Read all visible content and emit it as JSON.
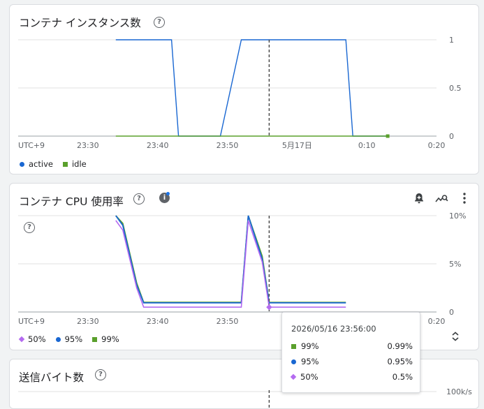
{
  "colors": {
    "active": "#1967d2",
    "idle": "#5aa02c",
    "p50": "#b46bf0",
    "p95": "#1967d2",
    "p99": "#5aa02c",
    "grid": "#e0e0e0",
    "cursor": "#444444"
  },
  "time_axis": {
    "tick_labels": [
      "UTC+9",
      "23:30",
      "23:40",
      "23:50",
      "5月17日",
      "0:10",
      "0:20"
    ]
  },
  "cards": {
    "instances": {
      "title": "コンテナ インスタンス数",
      "help": "?",
      "legend": [
        {
          "label": "active",
          "marker": "dot",
          "color": "#1967d2"
        },
        {
          "label": "idle",
          "marker": "square",
          "color": "#5aa02c"
        }
      ]
    },
    "cpu": {
      "title": "コンテナ CPU 使用率",
      "help": "?",
      "info": "i",
      "inner_help": "?",
      "toolbar": {
        "alert_icon": "add-alert-icon",
        "explore_icon": "query-stats-icon",
        "more_icon": "more-vert-icon"
      },
      "legend": [
        {
          "label": "50%",
          "marker": "diamond",
          "color": "#b46bf0"
        },
        {
          "label": "95%",
          "marker": "dot",
          "color": "#1967d2"
        },
        {
          "label": "99%",
          "marker": "square",
          "color": "#5aa02c"
        }
      ],
      "tooltip": {
        "date": "2026/05/16 23:56:00",
        "rows": [
          {
            "label": "99%",
            "value": "0.99%",
            "marker": "square",
            "color": "#5aa02c"
          },
          {
            "label": "95%",
            "value": "0.95%",
            "marker": "dot",
            "color": "#1967d2"
          },
          {
            "label": "50%",
            "value": "0.5%",
            "marker": "diamond",
            "color": "#b46bf0"
          }
        ]
      },
      "expand_icon": "unfold-icon"
    },
    "bytes": {
      "title": "送信バイト数",
      "help": "?"
    }
  },
  "chart_data": [
    {
      "type": "line",
      "title": "コンテナ インスタンス数",
      "x_ticks": [
        "23:30",
        "23:40",
        "23:50",
        "5月17日",
        "0:10",
        "0:20"
      ],
      "y_ticks": [
        "0",
        "0.5",
        "1"
      ],
      "ylim": [
        0,
        1
      ],
      "cursor_x": "23:56",
      "series": [
        {
          "name": "active",
          "points": [
            [
              "23:34",
              1
            ],
            [
              "23:42",
              1
            ],
            [
              "23:43",
              0
            ],
            [
              "23:49",
              0
            ],
            [
              "23:52",
              1
            ],
            [
              "0:07",
              1
            ],
            [
              "0:08",
              0
            ],
            [
              "0:13",
              0
            ]
          ]
        },
        {
          "name": "idle",
          "points": [
            [
              "23:34",
              0
            ],
            [
              "0:13",
              0
            ]
          ]
        }
      ]
    },
    {
      "type": "line",
      "title": "コンテナ CPU 使用率",
      "x_ticks": [
        "23:30",
        "23:40",
        "23:50",
        "5月17日",
        "0:10",
        "0:20"
      ],
      "y_ticks": [
        "0",
        "5%",
        "10%"
      ],
      "ylim": [
        0,
        10
      ],
      "cursor_x": "23:56",
      "series": [
        {
          "name": "99%",
          "points": [
            [
              "23:34",
              10
            ],
            [
              "23:35",
              9.2
            ],
            [
              "23:37",
              3
            ],
            [
              "23:38",
              1
            ],
            [
              "23:52",
              1
            ],
            [
              "23:53",
              10
            ],
            [
              "23:55",
              5.8
            ],
            [
              "23:56",
              0.99
            ],
            [
              "0:07",
              0.99
            ]
          ]
        },
        {
          "name": "95%",
          "points": [
            [
              "23:34",
              10
            ],
            [
              "23:35",
              9.0
            ],
            [
              "23:37",
              2.8
            ],
            [
              "23:38",
              0.95
            ],
            [
              "23:52",
              0.95
            ],
            [
              "23:53",
              10
            ],
            [
              "23:55",
              5.5
            ],
            [
              "23:56",
              0.95
            ],
            [
              "0:07",
              0.95
            ]
          ]
        },
        {
          "name": "50%",
          "points": [
            [
              "23:34",
              9.5
            ],
            [
              "23:35",
              8.5
            ],
            [
              "23:37",
              2.5
            ],
            [
              "23:38",
              0.5
            ],
            [
              "23:52",
              0.5
            ],
            [
              "23:53",
              9.5
            ],
            [
              "23:55",
              5.2
            ],
            [
              "23:56",
              0.5
            ],
            [
              "0:07",
              0.5
            ]
          ]
        }
      ]
    },
    {
      "type": "line",
      "title": "送信バイト数",
      "y_ticks": [
        "100k/s"
      ],
      "cursor_x": "23:56",
      "series": []
    }
  ]
}
